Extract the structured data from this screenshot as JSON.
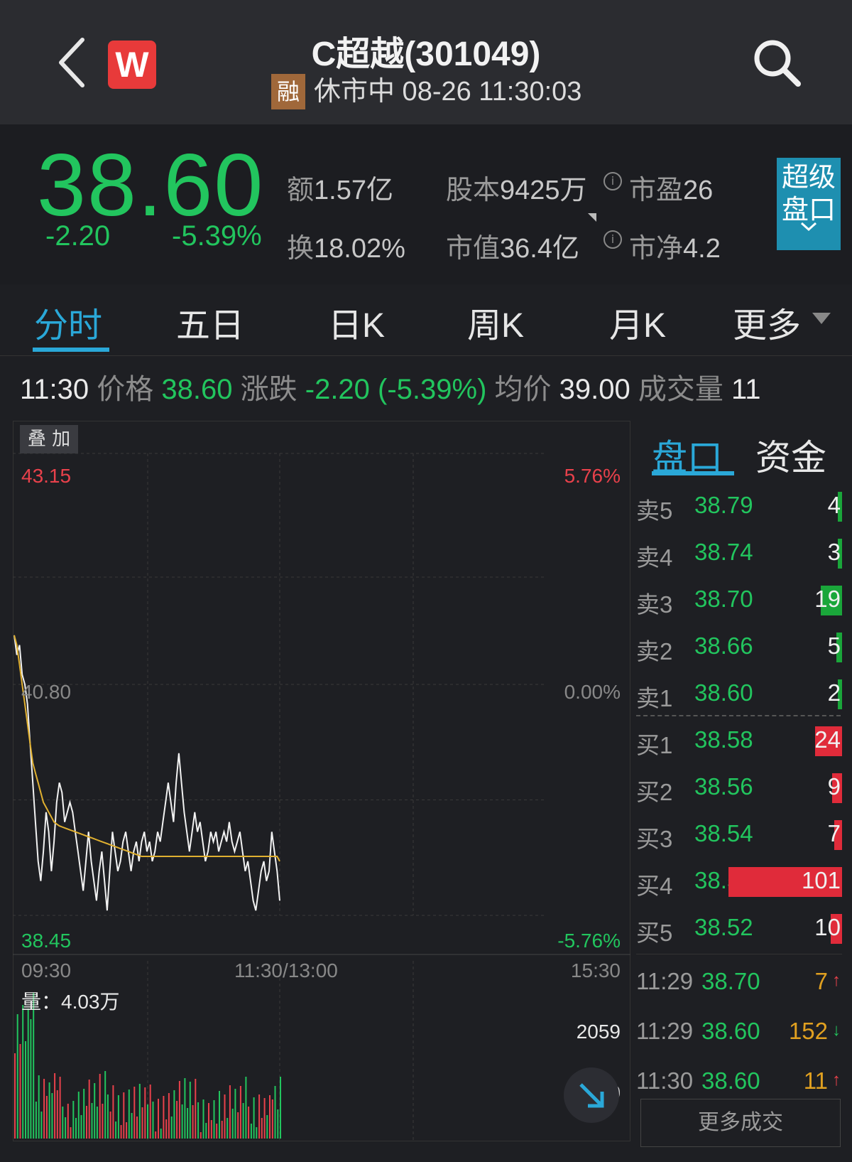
{
  "header": {
    "title": "C超越(301049)",
    "logo_letter": "W",
    "margin_badge": "融",
    "status_time": "休市中 08-26 11:30:03"
  },
  "quote": {
    "price": "38.60",
    "change": "-2.20",
    "change_pct": "-5.39%",
    "amount_label": "额",
    "amount": "1.57亿",
    "turnover_label": "换",
    "turnover": "18.02%",
    "share_cap_label": "股本",
    "share_cap": "9425万",
    "mkt_value_label": "市值",
    "mkt_value": "36.4亿",
    "pe_label": "市盈",
    "pe": "26",
    "pb_label": "市净",
    "pb": "4.2",
    "super_btn_line1": "超级",
    "super_btn_line2": "盘口"
  },
  "tabs": [
    "分时",
    "五日",
    "日K",
    "周K",
    "月K",
    "更多"
  ],
  "inforow": {
    "time": "11:30",
    "price_label": "价格",
    "price": "38.60",
    "chg_label": "涨跌",
    "chg": "-2.20 (-5.39%)",
    "avg_label": "均价",
    "avg": "39.00",
    "vol_label": "成交量",
    "vol": "11"
  },
  "chart": {
    "overlay_btn": "叠 加",
    "y_top": "43.15",
    "y_mid": "40.80",
    "y_bot": "38.45",
    "p_top": "5.76%",
    "p_mid": "0.00%",
    "p_bot": "-5.76%",
    "x_start": "09:30",
    "x_mid": "11:30/13:00",
    "x_end": "15:30",
    "vol_label": "量：4.03万",
    "vol_max": "2059",
    "vol_mid": "1030"
  },
  "chart_data": {
    "type": "line",
    "y_range": [
      38.45,
      43.15
    ],
    "pre_close": 40.8,
    "price_series": [
      41.3,
      41.1,
      41.2,
      40.9,
      40.8,
      40.6,
      40.2,
      39.8,
      39.4,
      39.0,
      38.8,
      39.1,
      39.5,
      39.3,
      38.9,
      39.2,
      39.6,
      39.8,
      39.7,
      39.4,
      39.5,
      39.6,
      39.5,
      39.3,
      39.1,
      38.9,
      38.7,
      39.0,
      39.3,
      39.0,
      38.8,
      38.6,
      38.9,
      39.1,
      38.8,
      38.5,
      38.9,
      39.3,
      39.1,
      38.9,
      39.0,
      39.2,
      39.3,
      39.1,
      38.9,
      39.1,
      39.2,
      39.0,
      39.2,
      39.3,
      39.1,
      39.2,
      39.0,
      39.1,
      39.3,
      39.2,
      39.4,
      39.6,
      39.8,
      39.6,
      39.4,
      39.8,
      40.1,
      39.8,
      39.5,
      39.3,
      39.1,
      39.3,
      39.5,
      39.3,
      39.4,
      39.2,
      39.0,
      39.1,
      39.3,
      39.2,
      39.3,
      39.1,
      39.2,
      39.3,
      39.2,
      39.4,
      39.2,
      39.1,
      39.2,
      39.3,
      39.1,
      38.9,
      39.0,
      38.8,
      38.6,
      38.5,
      38.7,
      38.9,
      39.0,
      38.8,
      38.9,
      39.3,
      39.1,
      38.9,
      38.6
    ],
    "avg_series": [
      41.3,
      41.2,
      41.0,
      40.8,
      40.6,
      40.4,
      40.2,
      40.0,
      39.9,
      39.8,
      39.7,
      39.6,
      39.55,
      39.5,
      39.45,
      39.4,
      39.38,
      39.36,
      39.35,
      39.34,
      39.33,
      39.32,
      39.31,
      39.3,
      39.29,
      39.28,
      39.27,
      39.26,
      39.25,
      39.24,
      39.23,
      39.22,
      39.21,
      39.2,
      39.19,
      39.18,
      39.17,
      39.16,
      39.15,
      39.14,
      39.13,
      39.12,
      39.11,
      39.1,
      39.09,
      39.08,
      39.07,
      39.06,
      39.05,
      39.05,
      39.05,
      39.05,
      39.05,
      39.05,
      39.05,
      39.05,
      39.05,
      39.05,
      39.05,
      39.05,
      39.05,
      39.05,
      39.05,
      39.05,
      39.05,
      39.05,
      39.05,
      39.05,
      39.05,
      39.05,
      39.05,
      39.05,
      39.05,
      39.05,
      39.05,
      39.05,
      39.05,
      39.05,
      39.05,
      39.05,
      39.05,
      39.05,
      39.05,
      39.05,
      39.05,
      39.05,
      39.05,
      39.05,
      39.05,
      39.05,
      39.05,
      39.05,
      39.05,
      39.05,
      39.05,
      39.05,
      39.05,
      39.05,
      39.05,
      39.05,
      39.0
    ],
    "volume_max": 2059
  },
  "orderbook": {
    "tabs": [
      "盘口",
      "资金"
    ],
    "asks": [
      {
        "label": "卖5",
        "price": "38.79",
        "vol": "4"
      },
      {
        "label": "卖4",
        "price": "38.74",
        "vol": "3"
      },
      {
        "label": "卖3",
        "price": "38.70",
        "vol": "19"
      },
      {
        "label": "卖2",
        "price": "38.66",
        "vol": "5"
      },
      {
        "label": "卖1",
        "price": "38.60",
        "vol": "2"
      }
    ],
    "bids": [
      {
        "label": "买1",
        "price": "38.58",
        "vol": "24"
      },
      {
        "label": "买2",
        "price": "38.56",
        "vol": "9"
      },
      {
        "label": "买3",
        "price": "38.54",
        "vol": "7"
      },
      {
        "label": "买4",
        "price": "38.53",
        "vol": "101"
      },
      {
        "label": "买5",
        "price": "38.52",
        "vol": "10"
      }
    ],
    "trades": [
      {
        "time": "11:29",
        "price": "38.70",
        "vol": "7",
        "dir": "↑"
      },
      {
        "time": "11:29",
        "price": "38.60",
        "vol": "152",
        "dir": "↓"
      },
      {
        "time": "11:30",
        "price": "38.60",
        "vol": "11",
        "dir": "↑"
      }
    ],
    "more_btn": "更多成交"
  },
  "colors": {
    "up": "#e8414b",
    "down": "#22c55e",
    "accent": "#2aa8d8"
  }
}
